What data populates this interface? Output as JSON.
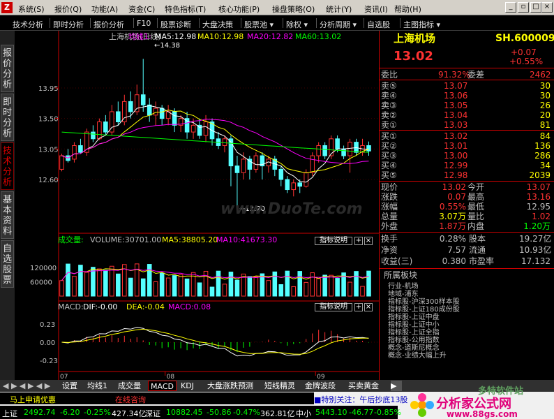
{
  "menu": {
    "items": [
      "系统(S)",
      "报价(Q)",
      "功能(A)",
      "资金(C)",
      "特色指标(T)",
      "核心功能(P)",
      "操盘策略(O)",
      "统计(Y)",
      "资讯(I)",
      "帮助(H)"
    ]
  },
  "toolbar": {
    "items": [
      "技术分析",
      "即时分析",
      "报价分析",
      "F10",
      "股票诊断",
      "大盘决策",
      "股票池 ▾",
      "除权 ▾",
      "分析周期 ▾",
      "自选股",
      "主图指标 ▾"
    ]
  },
  "left_tabs": [
    "报价分析",
    "即时分析",
    "技术分析",
    "基本资料",
    "自选股票"
  ],
  "main": {
    "title": "上海机场(日线)",
    "indicator": "均线1:",
    "ma5": "MA5:12.98",
    "ma10": "MA10:12.98",
    "ma20": "MA20:12.82",
    "ma60": "MA60:13.02",
    "high_label": "14.38",
    "low_label": "12.20",
    "watermark": "www.DuoTe.com",
    "yticks": [
      "13.95",
      "13.50",
      "13.05",
      "12.60"
    ]
  },
  "volume": {
    "label": "成交量:",
    "value": "VOLUME:30701.00",
    "ma5": "MA5:38805.20",
    "ma10": "MA10:41673.30",
    "help": "指标说明",
    "yticks": [
      "120000",
      "60000"
    ]
  },
  "macd": {
    "label": "MACD:",
    "dif": "DIF:-0.00",
    "dea": "DEA:-0.04",
    "macd": "MACD:0.08",
    "help": "指标说明",
    "yticks": [
      "0.23",
      "0.00",
      "-0.23"
    ],
    "xticks": [
      "07",
      "08",
      "09"
    ]
  },
  "quote": {
    "name": "上海机场",
    "code": "SH.600009",
    "price": "13.02",
    "chg": "+0.07",
    "chgpct": "+0.55%",
    "webi_label": "委比",
    "webi": "91.32%",
    "weicha_label": "委差",
    "weicha": "2462",
    "asks": [
      {
        "l": "卖⑤",
        "p": "13.07",
        "v": "30"
      },
      {
        "l": "卖④",
        "p": "13.06",
        "v": "30"
      },
      {
        "l": "卖③",
        "p": "13.05",
        "v": "26"
      },
      {
        "l": "卖②",
        "p": "13.04",
        "v": "20"
      },
      {
        "l": "卖①",
        "p": "13.03",
        "v": "81"
      }
    ],
    "bids": [
      {
        "l": "买①",
        "p": "13.02",
        "v": "84"
      },
      {
        "l": "买②",
        "p": "13.01",
        "v": "136"
      },
      {
        "l": "买③",
        "p": "13.00",
        "v": "286"
      },
      {
        "l": "买④",
        "p": "12.99",
        "v": "34"
      },
      {
        "l": "买⑤",
        "p": "12.98",
        "v": "2039"
      }
    ],
    "stats": [
      {
        "a": "现价",
        "b": "13.02",
        "c": "今开",
        "d": "13.07"
      },
      {
        "a": "涨跌",
        "b": "0.07",
        "c": "最高",
        "d": "13.16"
      },
      {
        "a": "涨幅",
        "b": "0.55%",
        "c": "最低",
        "d": "12.95"
      },
      {
        "a": "总量",
        "b": "3.07万",
        "c": "量比",
        "d": "1.02"
      },
      {
        "a": "外盘",
        "b": "1.87万",
        "c": "内盘",
        "d": "1.20万"
      }
    ],
    "stats2": [
      {
        "a": "换手",
        "b": "0.28%",
        "c": "股本",
        "d": "19.27亿"
      },
      {
        "a": "净资",
        "b": "7.57",
        "c": "流通",
        "d": "10.93亿"
      },
      {
        "a": "收益(三)",
        "b": "0.380",
        "c": "市盈率",
        "d": "17.132"
      }
    ],
    "sector_title": "所属板块",
    "sectors": [
      "行业-机场",
      "地域-浦东",
      "指标股-沪深300样本股",
      "指标股-上证180成份股",
      "指标股-上证中盘",
      "指标股-上证中小",
      "指标股-上证全指",
      "指标股-公用指数",
      "概念-道斯尼概念",
      "概念-业绩大幅上升"
    ]
  },
  "bottom_tabs": [
    "设置",
    "均线1",
    "成交量",
    "MACD",
    "KDJ",
    "大盘涨跌预测",
    "短线精灵",
    "金牌波段",
    "买卖黄金"
  ],
  "status": {
    "promo": "马上申请优惠",
    "consult": "在线咨询",
    "notice": "■特别关注：午后抄底13股",
    "sh_label": "上证",
    "sh": "2492.74",
    "sh_chg": "-6.20",
    "sh_pct": "-0.25%",
    "sh_amt": "427.34亿",
    "sz_label": "深证",
    "sz": "10882.45",
    "sz_chg": "-50.86",
    "sz_pct": "-0.47%",
    "sz_amt": "362.81亿",
    "zx_label": "中小",
    "zx": "5443.10",
    "zx_chg": "-46.77",
    "zx_pct": "-0.85%",
    "logo": "分析家公式网",
    "url": "www.88gs.com",
    "brand": "多特软件站"
  },
  "colors": {
    "up": "#ff3232",
    "down": "#54ffff",
    "ma5": "#ffffff",
    "ma10": "#ffff00",
    "ma20": "#ff00ff",
    "ma60": "#00ff00",
    "label": "#e00000"
  },
  "chart_data": [
    {
      "type": "candlestick",
      "title": "上海机场(日线)",
      "ylim": [
        12.2,
        14.38
      ],
      "series": [
        {
          "name": "MA5",
          "last": 12.98
        },
        {
          "name": "MA10",
          "last": 12.98
        },
        {
          "name": "MA20",
          "last": 12.82
        },
        {
          "name": "MA60",
          "last": 13.02
        }
      ],
      "yticks": [
        13.95,
        13.5,
        13.05,
        12.6
      ],
      "high": 14.38,
      "low": 12.2,
      "candles": [
        [
          12.75,
          12.95,
          12.72,
          12.98
        ],
        [
          12.95,
          12.88,
          12.85,
          13.05
        ],
        [
          12.9,
          13.1,
          12.85,
          13.15
        ],
        [
          13.1,
          13.0,
          12.98,
          13.2
        ],
        [
          13.0,
          13.3,
          12.95,
          13.35
        ],
        [
          13.3,
          13.2,
          13.15,
          13.4
        ],
        [
          13.2,
          13.45,
          13.18,
          13.5
        ],
        [
          13.45,
          13.3,
          13.25,
          13.55
        ],
        [
          13.3,
          13.6,
          13.25,
          13.7
        ],
        [
          13.6,
          13.45,
          13.4,
          13.75
        ],
        [
          13.45,
          13.75,
          13.4,
          13.85
        ],
        [
          13.75,
          13.6,
          13.5,
          13.9
        ],
        [
          13.6,
          13.85,
          13.55,
          14.0
        ],
        [
          13.85,
          13.7,
          13.6,
          14.38
        ],
        [
          13.7,
          13.55,
          13.45,
          13.8
        ],
        [
          13.55,
          13.65,
          13.4,
          13.75
        ],
        [
          13.65,
          13.5,
          13.4,
          13.7
        ],
        [
          13.5,
          13.6,
          13.4,
          13.7
        ],
        [
          13.6,
          13.4,
          13.3,
          13.65
        ],
        [
          13.4,
          13.5,
          13.3,
          13.55
        ],
        [
          13.5,
          13.3,
          13.2,
          13.6
        ],
        [
          13.3,
          13.4,
          13.2,
          13.5
        ],
        [
          13.4,
          13.25,
          13.2,
          13.5
        ],
        [
          13.25,
          13.45,
          13.15,
          13.55
        ],
        [
          13.45,
          13.2,
          13.1,
          13.5
        ],
        [
          13.2,
          13.1,
          13.05,
          13.3
        ],
        [
          13.1,
          13.2,
          13.0,
          13.25
        ],
        [
          13.2,
          12.8,
          12.5,
          13.25
        ],
        [
          12.8,
          12.7,
          12.2,
          12.95
        ],
        [
          12.7,
          12.9,
          12.6,
          13.0
        ],
        [
          12.9,
          12.75,
          12.6,
          12.95
        ],
        [
          12.75,
          12.95,
          12.7,
          13.0
        ],
        [
          12.95,
          12.8,
          12.6,
          13.0
        ],
        [
          12.8,
          12.9,
          12.7,
          12.95
        ],
        [
          12.9,
          12.75,
          12.65,
          12.95
        ],
        [
          12.75,
          12.6,
          12.5,
          12.8
        ],
        [
          12.6,
          12.45,
          12.4,
          12.65
        ],
        [
          12.45,
          12.55,
          12.35,
          12.6
        ],
        [
          12.55,
          12.5,
          12.4,
          12.6
        ],
        [
          12.5,
          12.7,
          12.48,
          12.75
        ],
        [
          12.7,
          12.95,
          12.65,
          13.0
        ],
        [
          12.95,
          13.1,
          12.85,
          13.15
        ],
        [
          13.1,
          12.95,
          12.9,
          13.15
        ],
        [
          12.95,
          13.2,
          12.9,
          13.25
        ],
        [
          13.2,
          13.05,
          13.0,
          13.25
        ],
        [
          13.05,
          12.95,
          12.9,
          13.1
        ],
        [
          12.95,
          13.15,
          12.7,
          13.2
        ],
        [
          13.15,
          13.0,
          12.95,
          13.2
        ],
        [
          13.0,
          13.1,
          12.95,
          13.2
        ],
        [
          13.1,
          13.02,
          12.95,
          13.16
        ]
      ]
    },
    {
      "type": "bar",
      "title": "成交量",
      "series": [
        {
          "name": "VOLUME",
          "last": 30701.0
        },
        {
          "name": "MA5",
          "last": 38805.2
        },
        {
          "name": "MA10",
          "last": 41673.3
        }
      ],
      "yticks": [
        120000,
        60000
      ]
    },
    {
      "type": "bar",
      "title": "MACD",
      "series": [
        {
          "name": "DIF",
          "last": -0.0
        },
        {
          "name": "DEA",
          "last": -0.04
        },
        {
          "name": "MACD",
          "last": 0.08
        }
      ],
      "yticks": [
        0.23,
        0.0,
        -0.23
      ],
      "xticks": [
        "07",
        "08",
        "09"
      ]
    }
  ]
}
